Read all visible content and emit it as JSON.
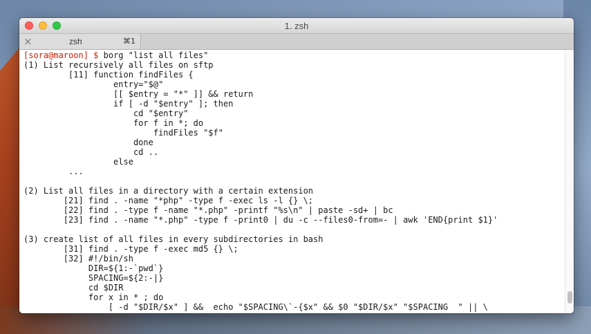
{
  "window": {
    "title": "1. zsh"
  },
  "tab": {
    "close_glyph": "×",
    "label": "zsh",
    "shortcut": "⌘1"
  },
  "terminal": {
    "prompt_user": "[sora@maroon]",
    "prompt_sign": "$",
    "command": " borg \"list all files\"",
    "lines": [
      "(1) List recursively all files on sftp",
      "         [11] function findFiles {",
      "                  entry=\"$@\"",
      "                  [[ $entry = \"*\" ]] && return",
      "                  if [ -d \"$entry\" ]; then",
      "                      cd \"$entry\"",
      "                      for f in *; do",
      "                          findFiles \"$f\"",
      "                      done",
      "                      cd ..",
      "                  else",
      "         ...",
      "",
      "(2) List all files in a directory with a certain extension",
      "        [21] find . -name \"*php\" -type f -exec ls -l {} \\;",
      "        [22] find . -type f -name \"*.php\" -printf \"%s\\n\" | paste -sd+ | bc",
      "        [23] find . -name \"*.php\" -type f -print0 | du -c --files0-from=- | awk 'END{print $1}'",
      "",
      "(3) create list of all files in every subdirectories in bash",
      "        [31] find . -type f -exec md5 {} \\;",
      "        [32] #!/bin/sh",
      "             DIR=${1:-`pwd`}",
      "             SPACING=${2:-|}",
      "             cd $DIR",
      "             for x in * ; do",
      "                 [ -d \"$DIR/$x\" ] &&  echo \"$SPACING\\`-{$x\" && $0 \"$DIR/$x\" \"$SPACING  \" || \\"
    ]
  }
}
